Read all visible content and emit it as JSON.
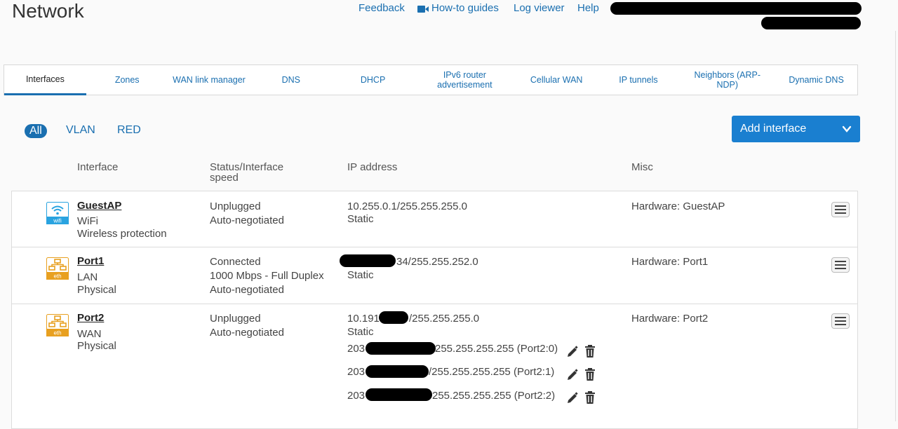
{
  "page": {
    "title": "Network"
  },
  "toplinks": {
    "feedback": "Feedback",
    "howto": "How-to guides",
    "logviewer": "Log viewer",
    "help": "Help"
  },
  "tabs": [
    "Interfaces",
    "Zones",
    "WAN link manager",
    "DNS",
    "DHCP",
    "IPv6 router advertisement",
    "Cellular WAN",
    "IP tunnels",
    "Neighbors (ARP-NDP)",
    "Dynamic DNS"
  ],
  "filters": {
    "all": "All",
    "vlan": "VLAN",
    "red": "RED"
  },
  "add_button": {
    "label": "Add interface"
  },
  "columns": {
    "interface": "Interface",
    "status": "Status/Interface speed",
    "ip": "IP address",
    "misc": "Misc"
  },
  "rows": [
    {
      "icon_label": "wifi",
      "icon": "wifi-icon",
      "name": "GuestAP",
      "zone": "WiFi",
      "type": "Wireless protection",
      "status": "Unplugged",
      "speed": "Auto-negotiated",
      "duplex": "",
      "ip": "10.255.0.1/255.255.255.0",
      "ip_mode": "Static",
      "misc": "Hardware:  GuestAP"
    },
    {
      "icon_label": "eth",
      "icon": "ethernet-icon",
      "name": "Port1",
      "zone": "LAN",
      "type": "Physical",
      "status": "Connected",
      "speed": "1000 Mbps - Full Duplex",
      "duplex": "Auto-negotiated",
      "ip": "34/255.255.252.0",
      "ip_mode": "Static",
      "misc": "Hardware:  Port1"
    },
    {
      "icon_label": "eth",
      "icon": "ethernet-icon",
      "name": "Port2",
      "zone": "WAN",
      "type": "Physical",
      "status": "Unplugged",
      "speed": "Auto-negotiated",
      "duplex": "",
      "ip_prefix": "10.191",
      "ip": "/255.255.255.0",
      "ip_mode": "Static",
      "misc": "Hardware:  Port2",
      "aliases": [
        {
          "prefix": "203",
          "suffix": "255.255.255.255 (Port2:0)"
        },
        {
          "prefix": "203",
          "suffix": "/255.255.255.255 (Port2:1)"
        },
        {
          "prefix": "203",
          "suffix": "255.255.255.255 (Port2:2)"
        }
      ]
    }
  ],
  "colors": {
    "accent": "#1a6fb0",
    "button": "#1a7fd0",
    "eth": "#e8a020",
    "wifi": "#29a3e0"
  }
}
